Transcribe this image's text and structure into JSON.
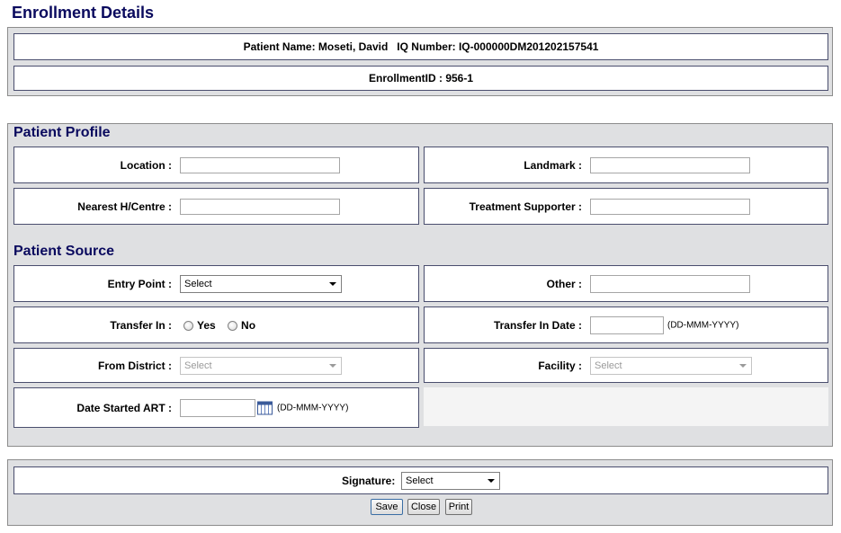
{
  "page": {
    "title": "Enrollment Details"
  },
  "header": {
    "patient_line": "Patient Name: Moseti, David   IQ Number: IQ-000000DM201202157541",
    "enrollment_line": "EnrollmentID : 956-1"
  },
  "profile": {
    "title": "Patient Profile",
    "location_label": "Location :",
    "location_value": "",
    "landmark_label": "Landmark :",
    "landmark_value": "",
    "nearest_label": "Nearest H/Centre :",
    "nearest_value": "",
    "supporter_label": "Treatment Supporter :",
    "supporter_value": ""
  },
  "source": {
    "title": "Patient Source",
    "entry_point_label": "Entry Point :",
    "entry_point_value": "Select",
    "other_label": "Other :",
    "other_value": "",
    "transfer_in_label": "Transfer In :",
    "transfer_yes": "Yes",
    "transfer_no": "No",
    "transfer_date_label": "Transfer In Date :",
    "transfer_date_value": "",
    "date_format_hint": "(DD-MMM-YYYY)",
    "district_label": "From District :",
    "district_value": "Select",
    "facility_label": "Facility :",
    "facility_value": "Select",
    "art_label": "Date Started ART :",
    "art_value": "",
    "art_format_hint": "(DD-MMM-YYYY)"
  },
  "footer": {
    "signature_label": "Signature:",
    "signature_value": "Select",
    "save_label": "Save",
    "close_label": "Close",
    "print_label": "Print"
  },
  "colors": {
    "heading": "#0a0a5e",
    "panel_bg": "#dfe0e2",
    "box_border": "#4a4e6e"
  }
}
